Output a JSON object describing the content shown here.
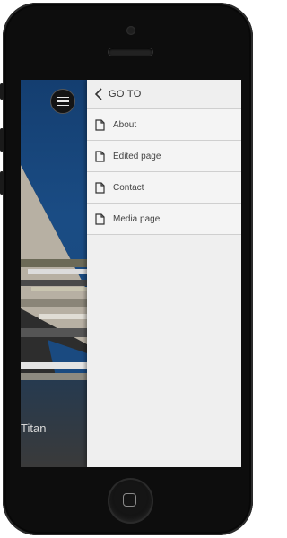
{
  "drawer": {
    "header_label": "GO TO",
    "items": [
      {
        "label": "About",
        "icon": "document-icon"
      },
      {
        "label": "Edited page",
        "icon": "document-icon"
      },
      {
        "label": "Contact",
        "icon": "document-icon"
      },
      {
        "label": "Media page",
        "icon": "document-icon"
      }
    ]
  },
  "background": {
    "title": "Titan"
  },
  "colors": {
    "drawer_bg": "#efefef",
    "screen_bg": "#1b4e86",
    "phone_body": "#0d0d0d"
  }
}
